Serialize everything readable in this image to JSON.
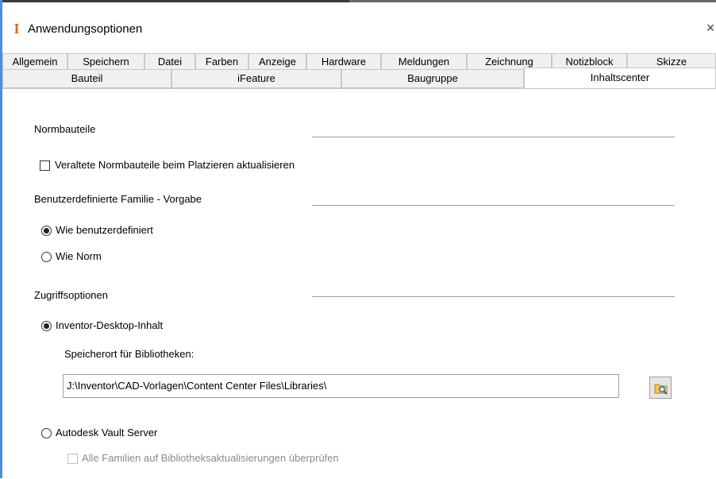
{
  "window": {
    "title": "Anwendungsoptionen",
    "app_icon_glyph": "I",
    "app_icon_color": "#d2691e",
    "close_glyph": "×"
  },
  "tabs_row1": [
    {
      "label": "Allgemein"
    },
    {
      "label": "Speichern"
    },
    {
      "label": "Datei"
    },
    {
      "label": "Farben"
    },
    {
      "label": "Anzeige"
    },
    {
      "label": "Hardware"
    },
    {
      "label": "Meldungen"
    },
    {
      "label": "Zeichnung"
    },
    {
      "label": "Notizblock"
    },
    {
      "label": "Skizze"
    }
  ],
  "tabs_row2": [
    {
      "label": "Bauteil"
    },
    {
      "label": "iFeature"
    },
    {
      "label": "Baugruppe"
    },
    {
      "label": "Inhaltscenter",
      "active": true
    }
  ],
  "sections": {
    "normbauteile": {
      "title": "Normbauteile",
      "checkbox_label": "Veraltete Normbauteile beim Platzieren aktualisieren",
      "checked": false
    },
    "familie": {
      "title": "Benutzerdefinierte Familie - Vorgabe",
      "options": [
        {
          "label": "Wie benutzerdefiniert",
          "checked": true
        },
        {
          "label": "Wie Norm",
          "checked": false
        }
      ]
    },
    "zugriff": {
      "title": "Zugriffsoptionen",
      "desktop_label": "Inventor-Desktop-Inhalt",
      "desktop_checked": true,
      "library_location_label": "Speicherort für Bibliotheken:",
      "library_path": "J:\\Inventor\\CAD-Vorlagen\\Content Center Files\\Libraries\\",
      "browse_icon": "folder-search-icon",
      "vault_label": "Autodesk Vault Server",
      "vault_checked": false,
      "check_updates_label": "Alle Familien auf Bibliotheksaktualisierungen überprüfen",
      "check_updates_enabled": false
    }
  }
}
